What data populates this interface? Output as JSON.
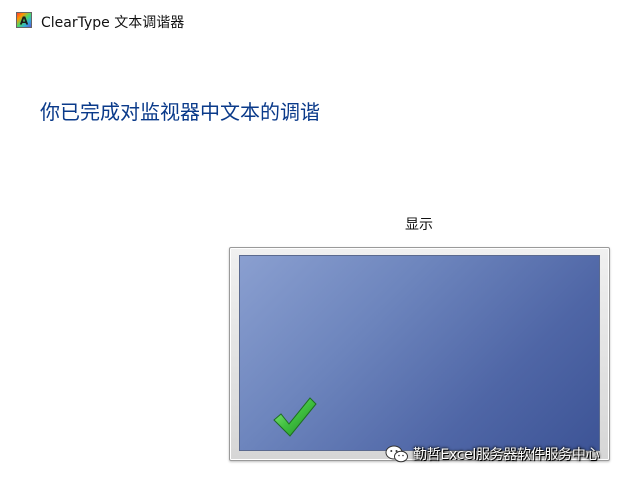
{
  "window": {
    "icon_letter": "A",
    "title": "ClearType 文本调谐器"
  },
  "page": {
    "heading": "你已完成对监视器中文本的调谐",
    "display_label": "显示"
  },
  "monitor": {
    "status_icon": "checkmark-icon",
    "screen_color": "#4f66a6",
    "check_color": "#3fbf3f"
  },
  "watermark": {
    "icon": "wechat-icon",
    "text": "勤哲Excel服务器软件服务中心"
  }
}
